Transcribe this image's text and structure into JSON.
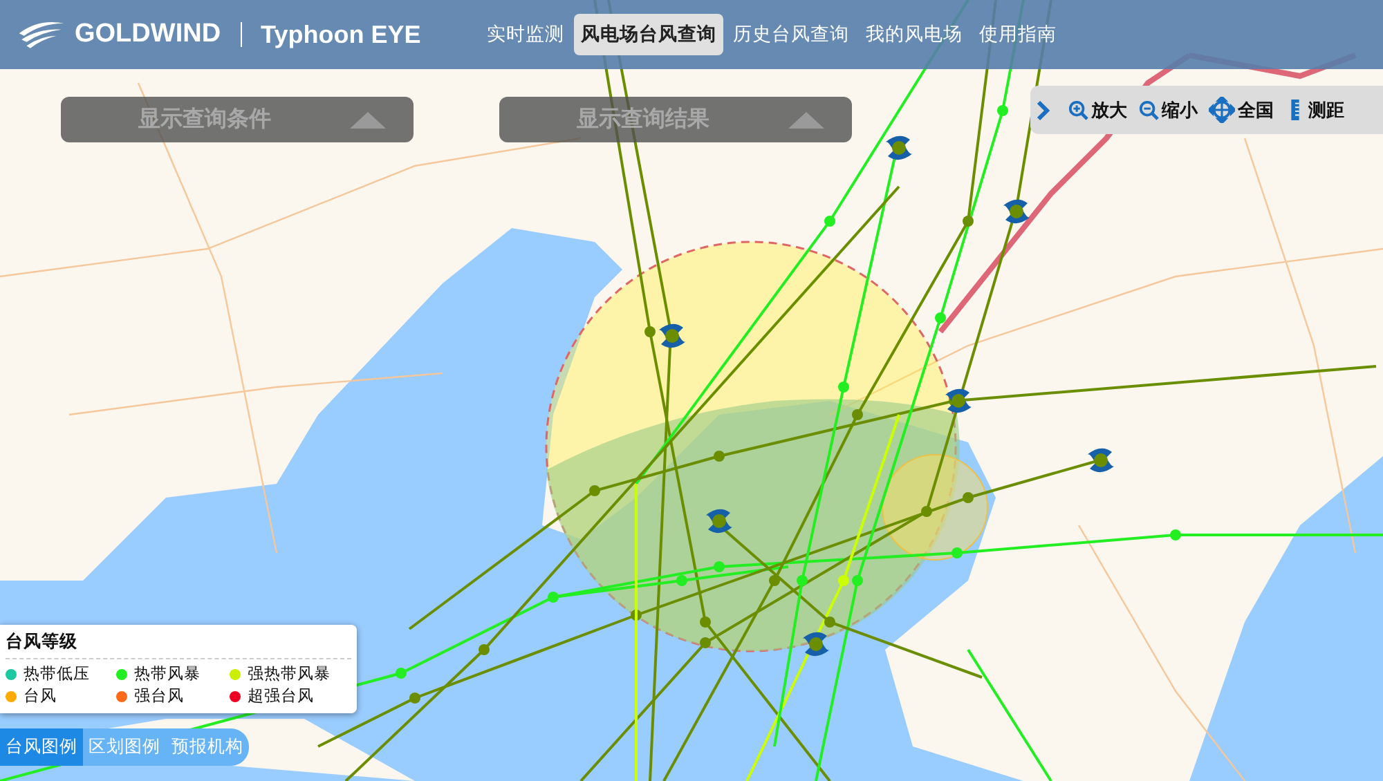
{
  "header": {
    "logo": "GOLDWIND",
    "product": "Typhoon EYE"
  },
  "nav": [
    {
      "label": "实时监测",
      "selected": false
    },
    {
      "label": "风电场台风查询",
      "selected": true
    },
    {
      "label": "历史台风查询",
      "selected": false
    },
    {
      "label": "我的风电场",
      "selected": false
    },
    {
      "label": "使用指南",
      "selected": false
    }
  ],
  "panels": [
    {
      "label": "显示查询条件"
    },
    {
      "label": "显示查询结果"
    }
  ],
  "toolbar": [
    {
      "label": "放大",
      "kind": "zoom-in"
    },
    {
      "label": "缩小",
      "kind": "zoom-out"
    },
    {
      "label": "全国",
      "kind": "pan"
    },
    {
      "label": "测距",
      "kind": "ruler"
    }
  ],
  "legend": {
    "title": "台风等级",
    "items": [
      {
        "label": "热带低压",
        "color": "#1dc7a0"
      },
      {
        "label": "热带风暴",
        "color": "#22ee22"
      },
      {
        "label": "强热带风暴",
        "color": "#ccee00"
      },
      {
        "label": "台风",
        "color": "#ffaa00"
      },
      {
        "label": "强台风",
        "color": "#ff6a1a"
      },
      {
        "label": "超强台风",
        "color": "#ee0022"
      }
    ]
  },
  "legend_tabs": [
    {
      "label": "台风图例",
      "selected": true
    },
    {
      "label": "区划图例",
      "selected": false
    },
    {
      "label": "预报机构",
      "selected": false
    }
  ]
}
